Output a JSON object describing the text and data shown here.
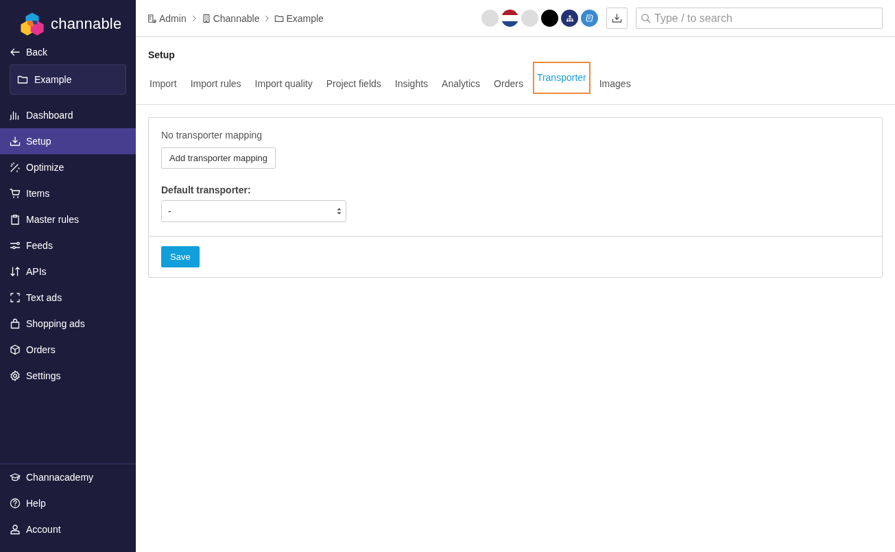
{
  "sidebar": {
    "logo": "channable",
    "back": "Back",
    "project": "Example",
    "items": [
      {
        "label": "Dashboard",
        "selected": false
      },
      {
        "label": "Setup",
        "selected": true
      },
      {
        "label": "Optimize",
        "selected": false
      },
      {
        "label": "Items",
        "selected": false
      },
      {
        "label": "Master rules",
        "selected": false
      },
      {
        "label": "Feeds",
        "selected": false
      },
      {
        "label": "APIs",
        "selected": false
      },
      {
        "label": "Text ads",
        "selected": false
      },
      {
        "label": "Shopping ads",
        "selected": false
      },
      {
        "label": "Orders",
        "selected": false
      },
      {
        "label": "Settings",
        "selected": false
      }
    ],
    "bottom_items": [
      {
        "label": "Channacademy"
      },
      {
        "label": "Help"
      },
      {
        "label": "Account"
      }
    ]
  },
  "breadcrumb": [
    "Admin",
    "Channable",
    "Example"
  ],
  "search": {
    "placeholder": "Type / to search"
  },
  "page": {
    "title": "Setup",
    "tabs": [
      {
        "label": "Import",
        "selected": false
      },
      {
        "label": "Import rules",
        "selected": false
      },
      {
        "label": "Import quality",
        "selected": false
      },
      {
        "label": "Project fields",
        "selected": false
      },
      {
        "label": "Insights",
        "selected": false
      },
      {
        "label": "Analytics",
        "selected": false
      },
      {
        "label": "Orders",
        "selected": false
      },
      {
        "label": "Transporter",
        "selected": true
      },
      {
        "label": "Images",
        "selected": false
      }
    ]
  },
  "card": {
    "message": "No transporter mapping",
    "add_button": "Add transporter mapping",
    "default_label": "Default transporter:",
    "default_value": "-",
    "save_button": "Save"
  }
}
